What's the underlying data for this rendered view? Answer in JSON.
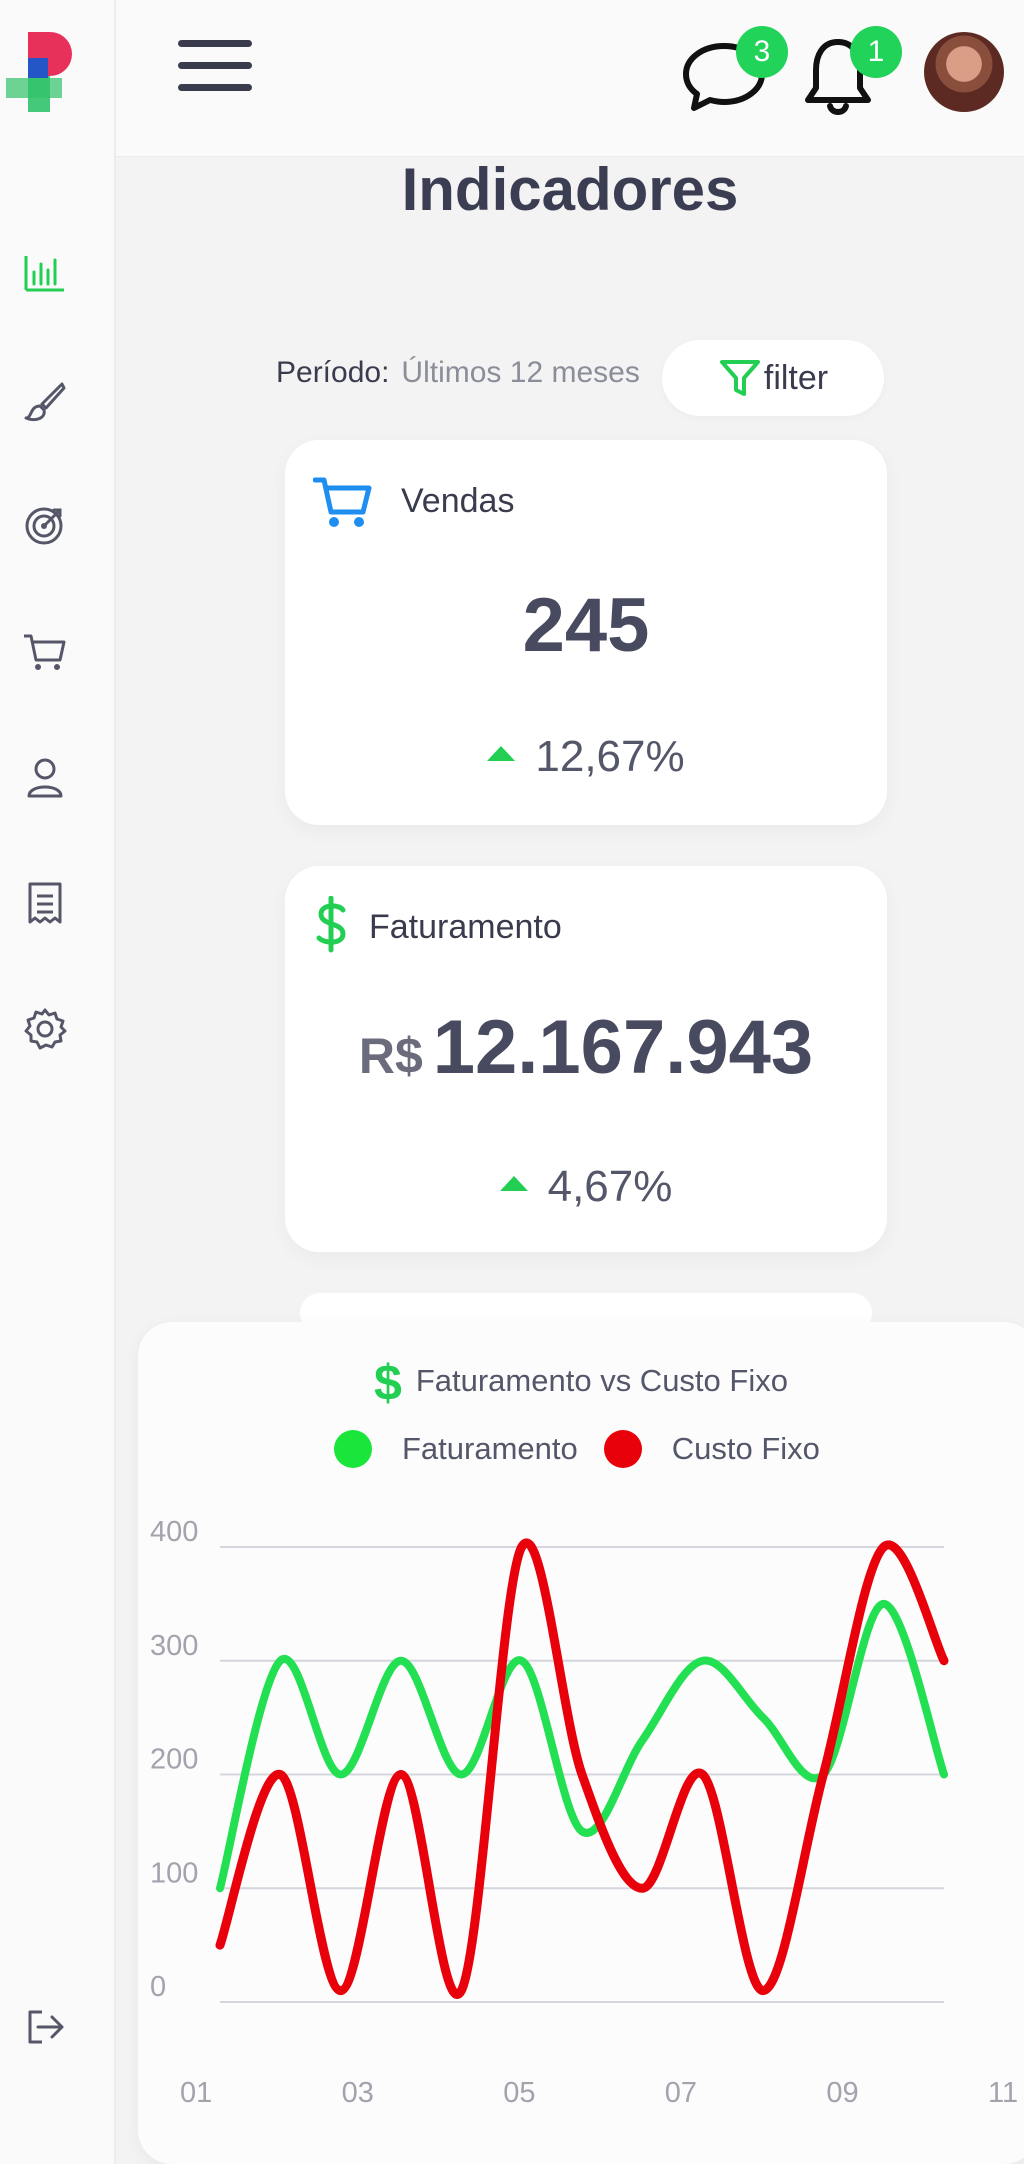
{
  "header": {
    "messages_badge": "3",
    "notifications_badge": "1"
  },
  "page": {
    "title": "Indicadores",
    "period_label": "Período:",
    "period_value": "Últimos 12 meses",
    "filter_label": "filter"
  },
  "cards": {
    "sales": {
      "title": "Vendas",
      "value": "245",
      "change": "12,67%"
    },
    "revenue": {
      "title": "Faturamento",
      "currency": "R$",
      "value": "12.167.943",
      "change": "4,67%"
    }
  },
  "colors": {
    "accent": "#22cf52",
    "sales_icon": "#1f8ef1",
    "revenue_series": "#22e052",
    "cost_series": "#e8000b",
    "text": "#3a3c4e"
  },
  "icons": [
    "logo",
    "chart-bar-icon",
    "paint-brush-icon",
    "target-icon",
    "cart-icon",
    "user-icon",
    "receipt-icon",
    "gear-icon",
    "logout-icon",
    "chat-icon",
    "bell-icon",
    "filter-icon",
    "dollar-icon"
  ],
  "chart_data": {
    "type": "line",
    "title": "Faturamento vs Custo Fixo",
    "x_ticks": [
      "01",
      "03",
      "05",
      "07",
      "09",
      "11"
    ],
    "y_ticks": [
      "0",
      "100",
      "200",
      "300",
      "400"
    ],
    "ylim": [
      0,
      400
    ],
    "xlim": [
      1,
      11
    ],
    "legend": [
      "Faturamento",
      "Custo Fixo"
    ],
    "legend_position": "top",
    "series": [
      {
        "name": "Faturamento",
        "color": "#22e052",
        "x": [
          1,
          1.5,
          2,
          2.5,
          3,
          3.5,
          4,
          4.5,
          5,
          5.5,
          6,
          6.5,
          7,
          7.5,
          8,
          8.5,
          9,
          9.5,
          10
        ],
        "y": [
          100,
          300,
          200,
          300,
          200,
          300,
          150,
          230,
          300,
          250,
          200,
          350,
          200,
          null,
          null,
          null,
          null,
          null,
          null
        ]
      },
      {
        "name": "Custo Fixo",
        "color": "#e8000b",
        "x": [
          1,
          1.5,
          2,
          2.5,
          3,
          3.5,
          4,
          4.5,
          5,
          5.5,
          6,
          6.5,
          7,
          7.5,
          8,
          8.5,
          9,
          9.5,
          10
        ],
        "y": [
          50,
          200,
          10,
          200,
          10,
          400,
          200,
          100,
          200,
          10,
          200,
          400,
          300,
          null,
          null,
          null,
          null,
          null,
          null
        ]
      }
    ]
  }
}
